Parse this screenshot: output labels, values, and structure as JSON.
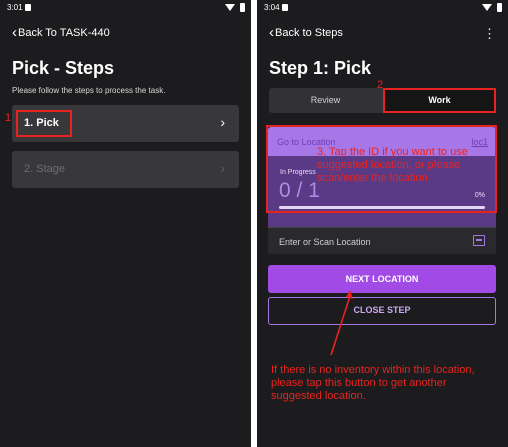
{
  "left_screen": {
    "status": {
      "time": "3:01"
    },
    "back_label": "Back To TASK-440",
    "title": "Pick - Steps",
    "subtitle": "Please follow the steps to process the task.",
    "steps": [
      {
        "label": "1. Pick",
        "enabled": true
      },
      {
        "label": "2. Stage",
        "enabled": false
      }
    ],
    "annotation_number": "1"
  },
  "right_screen": {
    "status": {
      "time": "3:04"
    },
    "back_label": "Back to Steps",
    "title": "Step 1: Pick",
    "tabs": {
      "review": "Review",
      "work": "Work"
    },
    "location": {
      "go_label": "Go to Location",
      "suggested": "loc1",
      "progress_label": "In Progress",
      "count": "0 / 1",
      "percent": "0%",
      "progress_fraction": 0,
      "scan_placeholder": "Enter or Scan Location"
    },
    "buttons": {
      "next": "NEXT LOCATION",
      "close": "CLOSE STEP"
    },
    "annotations": {
      "num2": "2",
      "note3": "3. Tap the ID if you want to use suggested location, or please scan/enter the location",
      "bottom_note": "If there is no inventory within this location, please tap this button to get another suggested location."
    }
  },
  "colors": {
    "background": "#1c1c1e",
    "accent": "#a14ae6",
    "annotation": "#e8231f"
  }
}
